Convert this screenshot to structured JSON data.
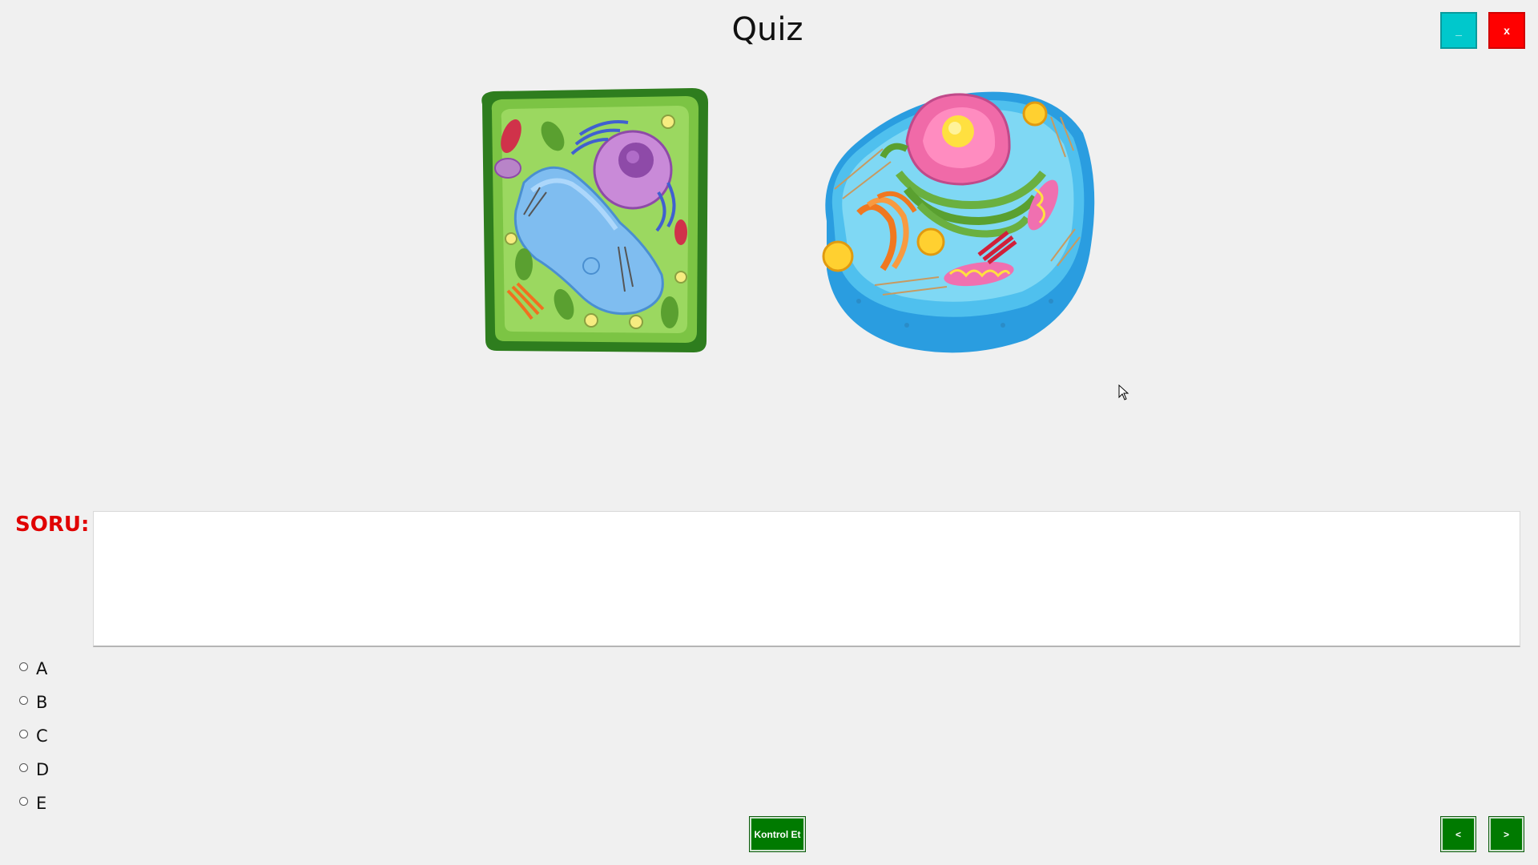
{
  "window": {
    "title": "Quiz",
    "minimize_label": "_",
    "close_label": "x"
  },
  "images": {
    "plant_cell": "plant-cell-illustration",
    "animal_cell": "animal-cell-illustration"
  },
  "question": {
    "label": "SORU:",
    "text": ""
  },
  "options": [
    {
      "label": "A"
    },
    {
      "label": "B"
    },
    {
      "label": "C"
    },
    {
      "label": "D"
    },
    {
      "label": "E"
    }
  ],
  "buttons": {
    "check_label": "Kontrol Et",
    "prev_label": "<",
    "next_label": ">"
  },
  "colors": {
    "background": "#f0f0f0",
    "minimize": "#00c8cc",
    "close": "#ff0000",
    "question_label": "#e00000",
    "action_green": "#007a00"
  }
}
